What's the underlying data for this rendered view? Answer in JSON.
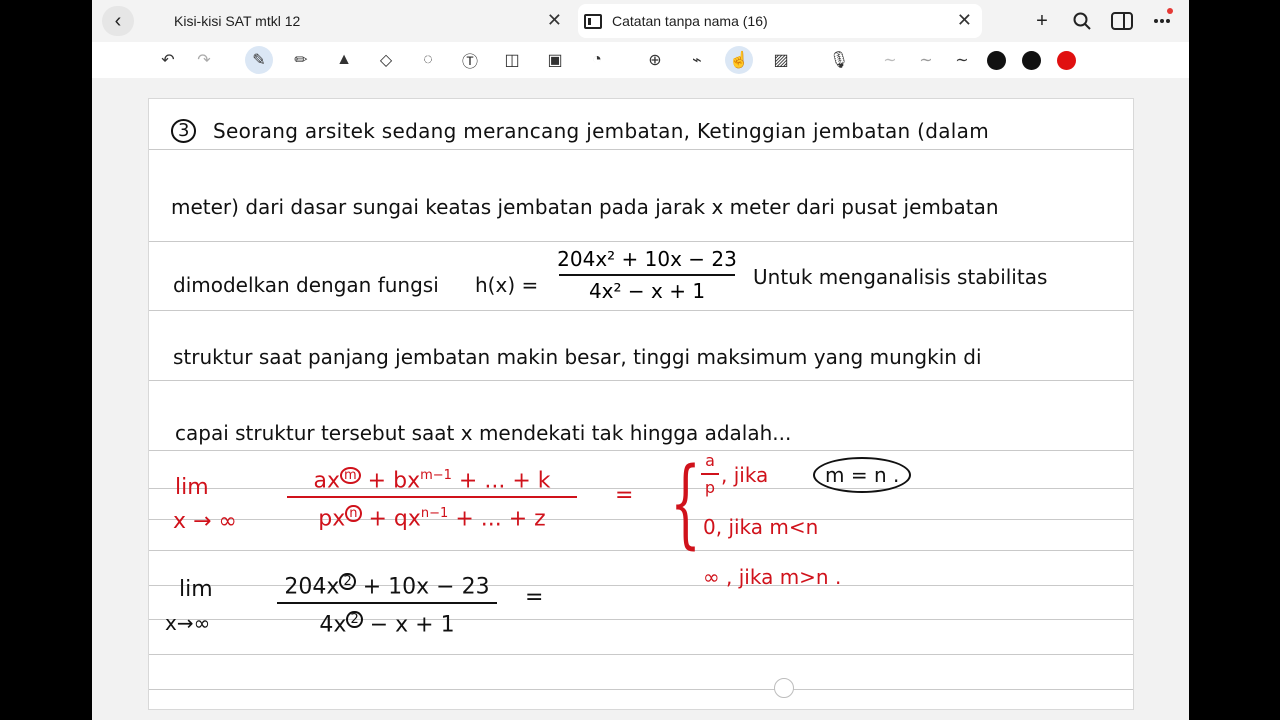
{
  "tabs": [
    {
      "label": "Kisi-kisi SAT mtkl 12"
    },
    {
      "label": "Catatan tanpa nama (16)"
    }
  ],
  "icons": {
    "back": "chevron-left-icon",
    "new_tab": "plus-icon",
    "search": "search-icon",
    "sidebar": "sidebar-icon",
    "more": "more-icon"
  },
  "toolbar": {
    "tools": [
      "undo",
      "redo",
      "pen",
      "pencil",
      "highlighter",
      "eraser",
      "lasso",
      "text",
      "shapes",
      "image",
      "sticker",
      "zoom",
      "laser",
      "touch",
      "grid",
      "microphone",
      "line-thin",
      "line-medium",
      "line-thick"
    ],
    "colors": [
      "#111111",
      "#111111",
      "#e01010"
    ]
  },
  "note": {
    "problem_number": "3",
    "lines": [
      "Seorang arsitek sedang merancang jembatan, Ketinggian jembatan (dalam",
      "meter) dari dasar sungai keatas jembatan pada jarak x meter dari pusat jembatan",
      "dimodelkan dengan fungsi",
      "Untuk menganalisis stabilitas",
      "struktur saat panjang jembatan makin besar, tinggi maksimum yang mungkin di",
      "capai struktur tersebut saat x mendekati tak hingga adalah..."
    ],
    "h_label": "h(x) =",
    "h_num": "204x² + 10x − 23",
    "h_den": "4x² − x + 1",
    "rule_lim": "lim",
    "rule_sub": "x → ∞",
    "rule_num_a": "ax",
    "rule_num_m": "m",
    "rule_num_rest": " + bx",
    "rule_num_rest_sup": "m−1",
    "rule_num_tail": " + ... + k",
    "rule_den_a": "px",
    "rule_den_n": "n",
    "rule_den_rest": " + qx",
    "rule_den_rest_sup": "n−1",
    "rule_den_tail": " + ... + z",
    "equals": "=",
    "case1_num": "a",
    "case1_den": "p",
    "case1_cond": ", jika",
    "case1_circled": "m = n .",
    "case2": "0,  jika   m<n",
    "case3": "∞ ,  jika   m>n .",
    "ex_lim": "lim",
    "ex_sub": "x→∞",
    "ex_num_a": "204x",
    "ex_num_sup": "2",
    "ex_num_tail": " + 10x − 23",
    "ex_den_a": "4x",
    "ex_den_sup": "2",
    "ex_den_tail": " − x + 1",
    "ex_equals": "="
  }
}
